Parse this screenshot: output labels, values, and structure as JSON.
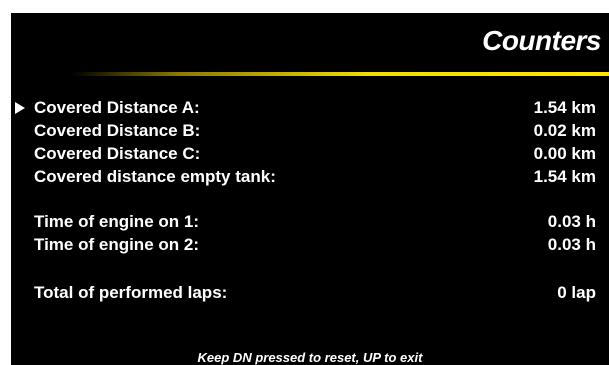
{
  "header": {
    "title": "Counters"
  },
  "colors": {
    "background": "#000000",
    "text": "#ffffff",
    "accent": "#f2dd00"
  },
  "rows": [
    {
      "label": "Covered Distance A:",
      "value": "1.54 km",
      "selected": true
    },
    {
      "label": "Covered Distance B:",
      "value": "0.02 km"
    },
    {
      "label": "Covered Distance C:",
      "value": "0.00 km"
    },
    {
      "label": "Covered distance empty tank:",
      "value": "1.54 km"
    },
    {
      "label": "Time of engine on 1:",
      "value": "0.03 h"
    },
    {
      "label": "Time of engine on 2:",
      "value": "0.03 h"
    },
    {
      "label": "Total of performed laps:",
      "value": "0 lap"
    }
  ],
  "footer": {
    "hint": "Keep DN pressed to reset, UP to exit"
  },
  "icons": {
    "cursor": "selection-arrow-icon"
  }
}
